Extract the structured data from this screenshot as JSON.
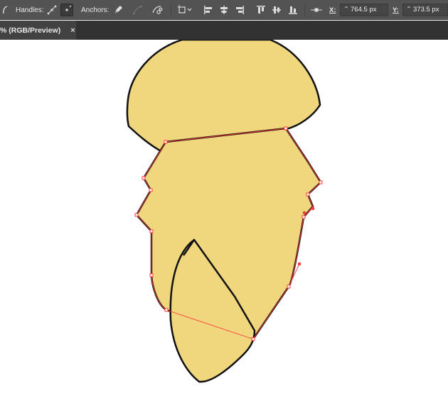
{
  "toolbar": {
    "handles_label": "Handles:",
    "anchors_label": "Anchors:",
    "x_label": "X:",
    "x_value": "764.5 px",
    "y_label": "Y:",
    "y_value": "373.5 px"
  },
  "tab": {
    "title": "% (RGB/Preview)",
    "close_glyph": "×"
  },
  "colors": {
    "toolbar_bg": "#535353",
    "tab_bar_bg": "#323232",
    "shape_fill": "#f0d77e",
    "outline": "#111111",
    "selection_path": "#ff3b3b"
  }
}
